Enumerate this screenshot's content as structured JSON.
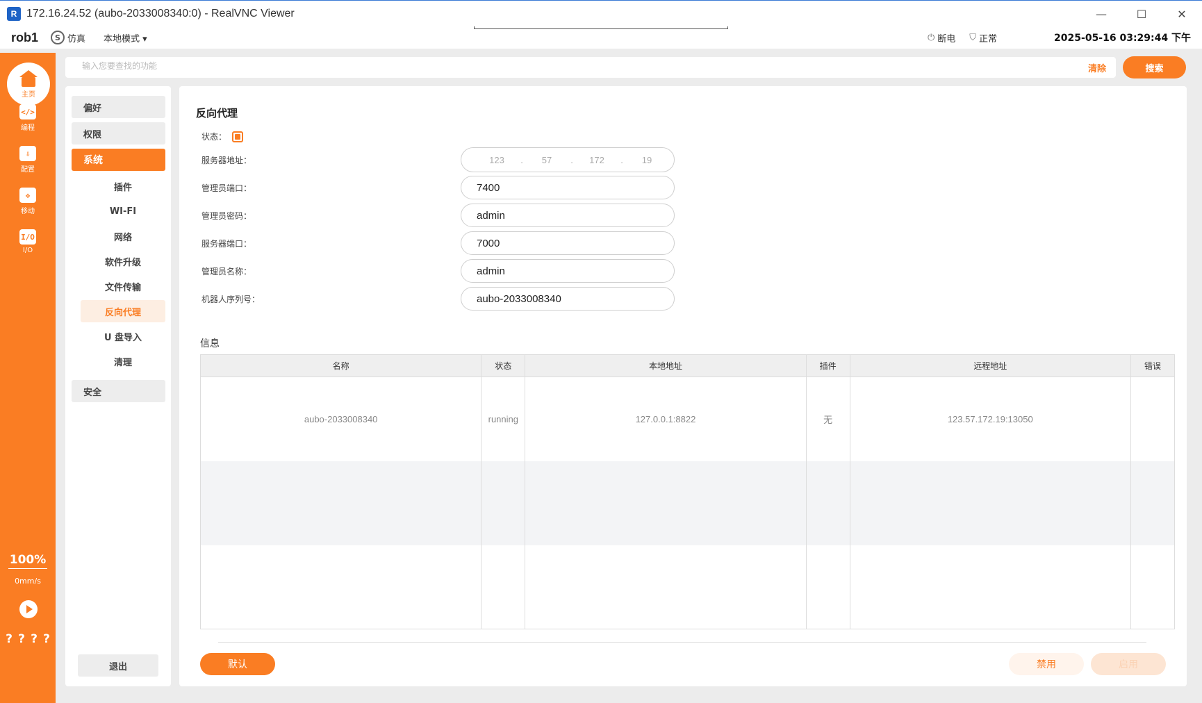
{
  "window": {
    "title": "172.16.24.52 (aubo-2033008340:0) - RealVNC Viewer",
    "logo": "R",
    "min": "—",
    "max": "☐",
    "close": "✕"
  },
  "appbar": {
    "robot": "rob1",
    "sim_icon": "S",
    "sim_label": "仿真",
    "mode": "本地模式 ▾",
    "power_icon": "⏻",
    "power_label": "断电",
    "shield_icon": "⛉",
    "status_label": "正常",
    "datetime": "2025-05-16 03:29:44 下午"
  },
  "rail": {
    "home": "主页",
    "items": [
      {
        "icon": "</>",
        "label": "编程"
      },
      {
        "icon": "⇩",
        "label": "配置"
      },
      {
        "icon": "✥",
        "label": "移动"
      },
      {
        "icon": "I/O",
        "label": "I/O"
      }
    ],
    "speed": "100%",
    "mms": "0mm/s",
    "q1": "?",
    "q2": "?",
    "q3": "?",
    "q4": "?"
  },
  "search": {
    "placeholder": "输入您要查找的功能",
    "clear": "清除",
    "button": "搜索"
  },
  "nav": {
    "preferences": "偏好",
    "permissions": "权限",
    "system": "系统",
    "subs": [
      "插件",
      "WI-FI",
      "网络",
      "软件升级",
      "文件传输",
      "反向代理",
      "U 盘导入",
      "清理"
    ],
    "security": "安全",
    "logout": "退出"
  },
  "form": {
    "title": "反向代理",
    "status_label": "状态：",
    "server_addr_label": "服务器地址：",
    "ip": [
      "123",
      "57",
      "172",
      "19"
    ],
    "ip_dot": ".",
    "admin_port_label": "管理员端口：",
    "admin_port": "7400",
    "admin_pwd_label": "管理员密码：",
    "admin_pwd": "admin",
    "server_port_label": "服务器端口：",
    "server_port": "7000",
    "admin_name_label": "管理员名称：",
    "admin_name": "admin",
    "serial_label": "机器人序列号：",
    "serial": "aubo-2033008340"
  },
  "info": {
    "title": "信息",
    "headers": [
      "名称",
      "状态",
      "本地地址",
      "插件",
      "远程地址",
      "错误"
    ],
    "rows": [
      [
        "aubo-2033008340",
        "running",
        "127.0.0.1:8822",
        "无",
        "123.57.172.19:13050",
        ""
      ],
      [
        "",
        "",
        "",
        "",
        "",
        ""
      ],
      [
        "",
        "",
        "",
        "",
        "",
        ""
      ]
    ]
  },
  "buttons": {
    "default": "默认",
    "disable": "禁用",
    "enable": "启用"
  },
  "colors": {
    "accent": "#fa7d23",
    "accent_light": "#fdeee2"
  }
}
